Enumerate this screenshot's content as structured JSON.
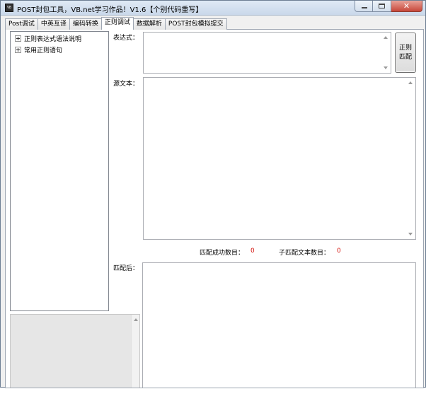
{
  "window": {
    "title": "POST封包工具，VB.net学习作品！V1.6【个别代码重写】",
    "icon_text": "VB"
  },
  "tabs": [
    {
      "label": "Post调试"
    },
    {
      "label": "中英互译"
    },
    {
      "label": "编码转换"
    },
    {
      "label": "正则调试",
      "active": true
    },
    {
      "label": "数据解析"
    },
    {
      "label": "POST封包模拟提交"
    }
  ],
  "tree": {
    "items": [
      {
        "label": "正则表达式语法说明"
      },
      {
        "label": "常用正则语句"
      }
    ]
  },
  "form": {
    "expression_label": "表达式：",
    "expression_value": "",
    "source_label": "源文本：",
    "source_value": "",
    "result_label": "匹配后：",
    "result_value": "",
    "match_button_line1": "正则",
    "match_button_line2": "匹配"
  },
  "stats": {
    "match_count_label": "匹配成功数目：",
    "match_count_value": "0",
    "submatch_count_label": "子匹配文本数目：",
    "submatch_count_value": "0",
    "value_color": "#d4120c"
  }
}
